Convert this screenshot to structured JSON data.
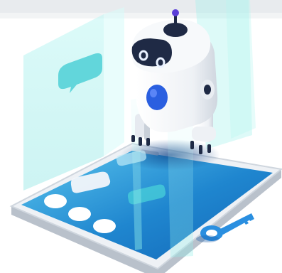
{
  "scene": {
    "subject": "robot-on-smartphone-illustration",
    "colors": {
      "teal_panel": "#9ef0ec",
      "screen_blue": "#1a7fc9",
      "screen_light": "#63c8ee",
      "robot_white": "#f3f5f8",
      "robot_dark": "#1f2a45",
      "accent_blue": "#2a5fe0",
      "key_blue": "#2a8fe0",
      "phone_gray": "#dfe4ea"
    }
  }
}
